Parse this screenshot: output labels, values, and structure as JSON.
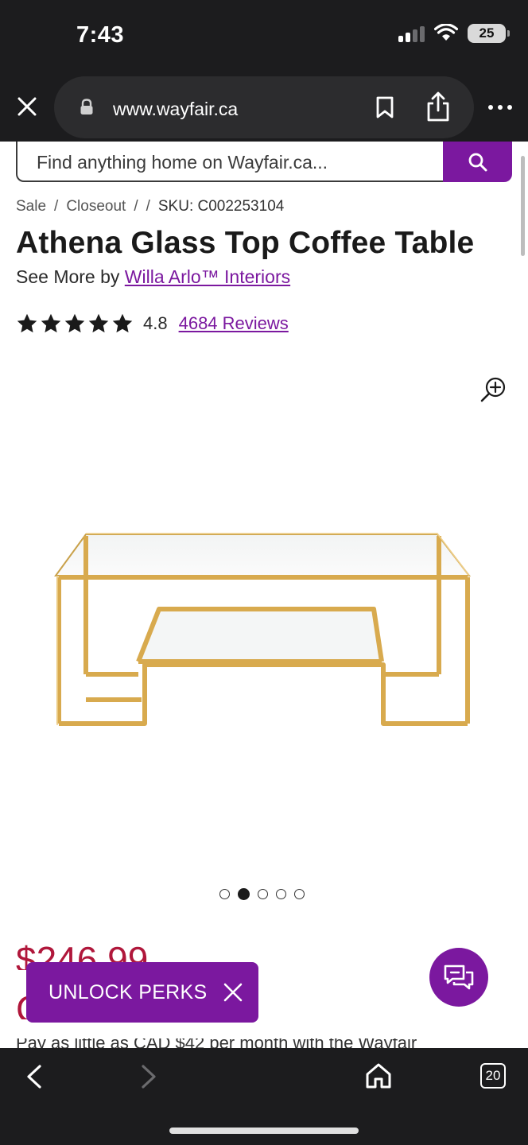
{
  "status_bar": {
    "time": "7:43",
    "battery": "25"
  },
  "browser": {
    "url": "www.wayfair.ca",
    "tab_count": "20"
  },
  "search": {
    "placeholder": "Find anything home on Wayfair.ca..."
  },
  "breadcrumb": {
    "items": [
      "Sale",
      "/",
      "Closeout",
      "/",
      "/",
      "SKU: C002253104"
    ]
  },
  "product": {
    "title": "Athena Glass Top Coffee Table",
    "see_more_prefix": "See More by",
    "brand": "Willa Arlo™ Interiors",
    "rating": "4.8",
    "stars": 5,
    "reviews": "4684 Reviews",
    "price_partial": "$246.99",
    "promo_partial": "Pay as little as CAD $42 per month with the Wayfair"
  },
  "carousel": {
    "count": 5,
    "active_index": 1
  },
  "promo": {
    "unlock_label": "UNLOCK PERKS"
  },
  "colors": {
    "brand_purple": "#7b189f",
    "price_red": "#b0173b",
    "chrome_dark": "#1c1c1e",
    "gold": "#d8aa4e"
  },
  "icons": [
    "close-icon",
    "lock-icon",
    "bookmark-icon",
    "share-icon",
    "more-icon",
    "search-icon",
    "star-icon",
    "zoom-in-icon",
    "chat-icon",
    "back-icon",
    "forward-icon",
    "home-icon",
    "tabs-icon"
  ]
}
